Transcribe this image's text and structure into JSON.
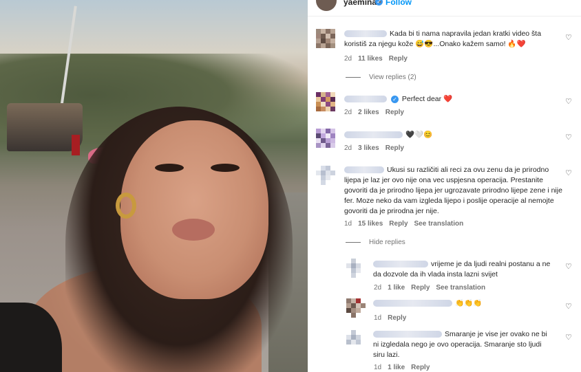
{
  "post": {
    "username": "yaemina",
    "follow_label": "Follow",
    "separator": "•"
  },
  "comments": [
    {
      "text": "Kada bi ti nama napravila jedan kratki video šta koristiš za njegu kože 😅😎...Onako kažem samo! 🔥❤️",
      "time": "2d",
      "likes": "11 likes",
      "reply": "Reply",
      "view_replies": "View replies (2)"
    },
    {
      "text": "Perfect dear ❤️",
      "time": "2d",
      "likes": "2 likes",
      "reply": "Reply"
    },
    {
      "text": "🖤🤍😊",
      "time": "2d",
      "likes": "3 likes",
      "reply": "Reply"
    },
    {
      "text": "Ukusi su različiti ali reci za ovu zenu da je prirodno lijepa je laz jer ovo nije ona vec uspjesna operacija. Prestanite govoriti da je prirodno lijepa jer ugrozavate prirodno lijepe zene i nije fer. Moze neko da vam izgleda lijepo i poslije operacije al nemojte govoriti da je prirodna jer nije.",
      "time": "1d",
      "likes": "15 likes",
      "reply": "Reply",
      "translate": "See translation",
      "hide_replies": "Hide replies"
    }
  ],
  "replies": [
    {
      "text": "vrijeme je da ljudi realni postanu a ne da dozvole da ih vlada insta lazni svijet",
      "time": "2d",
      "likes": "1 like",
      "reply": "Reply",
      "translate": "See translation"
    },
    {
      "text": "👏👏👏",
      "time": "1d",
      "reply": "Reply"
    },
    {
      "text": "Smaranje je vise jer ovako ne bi ni izgledala nego je ovo operacija. Smaranje sto ljudi siru lazi.",
      "time": "1d",
      "likes": "1 like",
      "reply": "Reply"
    }
  ],
  "icons": {
    "like": "heart-outline-icon",
    "verified": "verified-badge-icon"
  },
  "colors": {
    "link": "#0095f6",
    "muted": "#737373",
    "text": "#262626"
  }
}
